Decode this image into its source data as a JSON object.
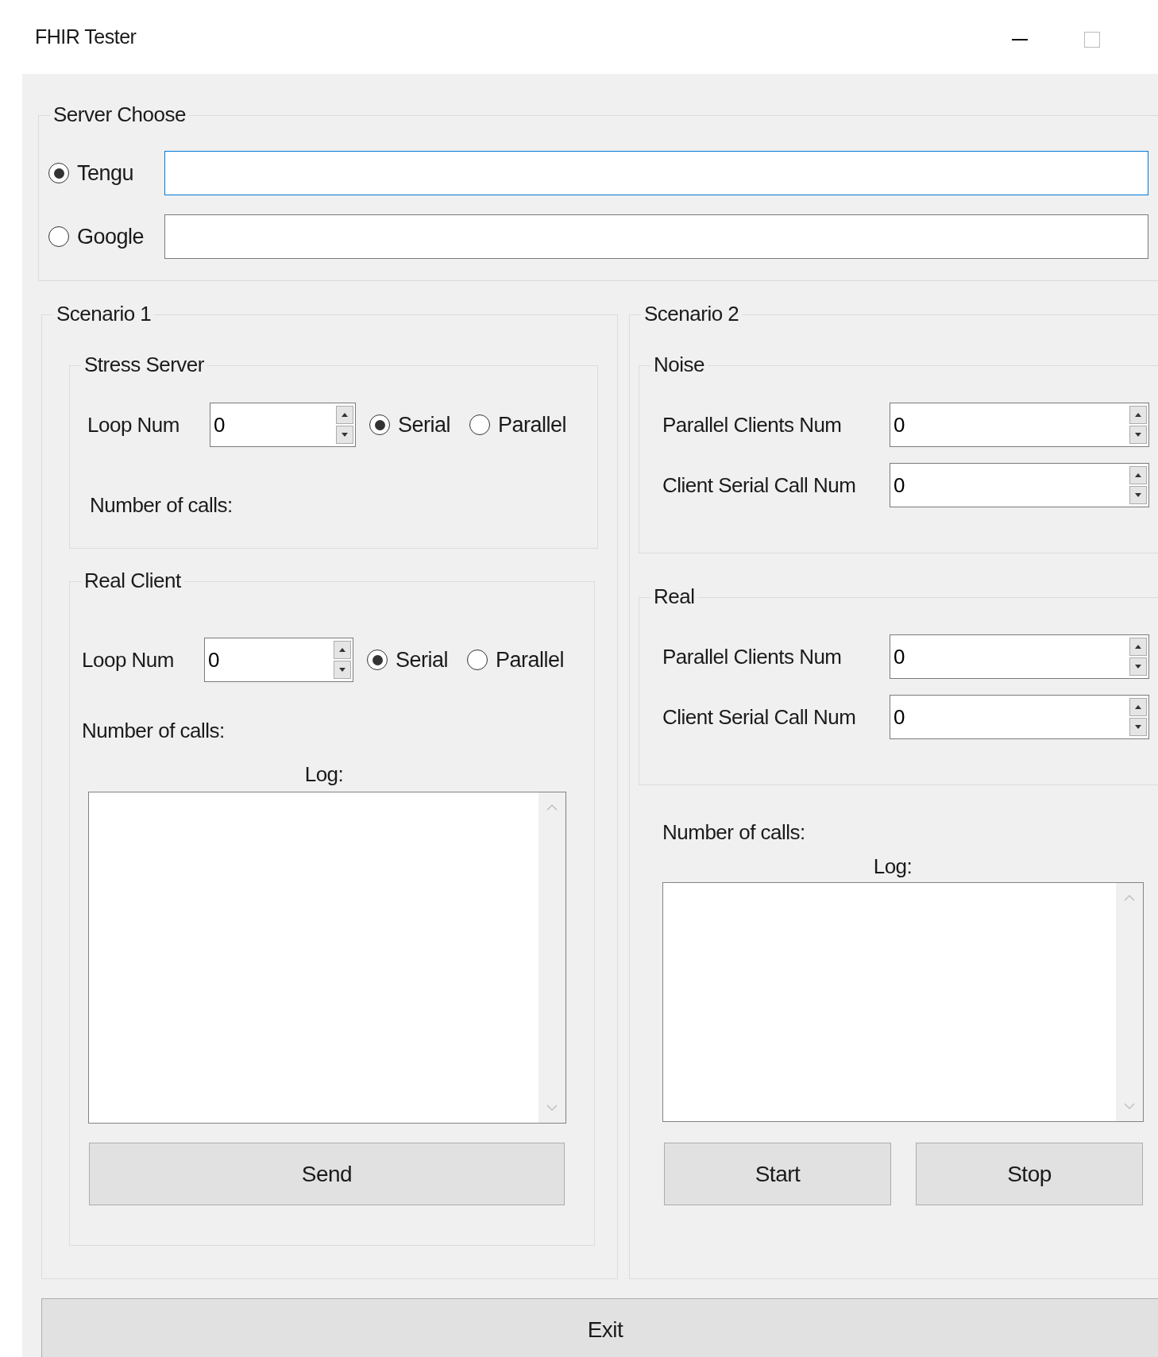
{
  "window": {
    "title": "FHIR Tester"
  },
  "server_choose": {
    "title": "Server Choose",
    "options": [
      {
        "label": "Tengu",
        "selected": true,
        "focused": true
      },
      {
        "label": "Google",
        "selected": false,
        "focused": false
      }
    ]
  },
  "scenario_1": {
    "title": "Scenario 1",
    "stress_server": {
      "title": "Stress Server",
      "loop_label": "Loop Num",
      "loop_value": "0",
      "modes": [
        {
          "label": "Serial",
          "selected": true
        },
        {
          "label": "Parallel",
          "selected": false
        }
      ],
      "calls_label": "Number of calls:"
    },
    "real_client": {
      "title": "Real Client",
      "loop_label": "Loop Num",
      "loop_value": "0",
      "modes": [
        {
          "label": "Serial",
          "selected": true
        },
        {
          "label": "Parallel",
          "selected": false
        }
      ],
      "calls_label": "Number of calls:",
      "log_label": "Log:",
      "button": "Send"
    }
  },
  "scenario_2": {
    "title": "Scenario 2",
    "noise": {
      "title": "Noise",
      "fields": [
        {
          "label": "Parallel Clients Num",
          "value": "0"
        },
        {
          "label": "Client Serial Call Num",
          "value": "0"
        }
      ]
    },
    "real": {
      "title": "Real",
      "fields": [
        {
          "label": "Parallel Clients Num",
          "value": "0"
        },
        {
          "label": "Client Serial Call Num",
          "value": "0"
        }
      ]
    },
    "calls_label": "Number of calls:",
    "log_label": "Log:",
    "buttons": [
      "Start",
      "Stop"
    ]
  },
  "exit_button": "Exit"
}
